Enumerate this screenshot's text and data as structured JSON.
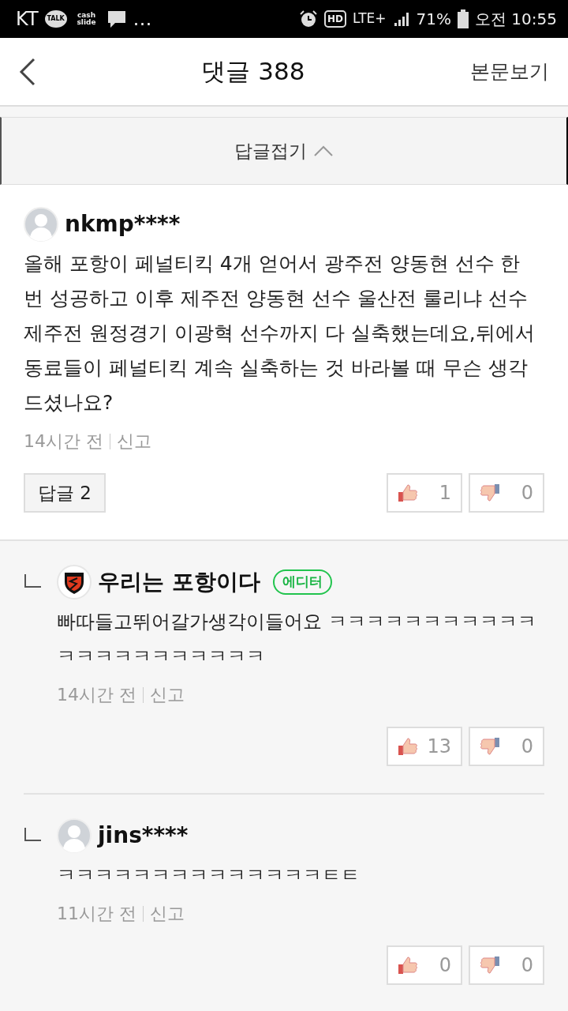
{
  "status_bar": {
    "carrier": "KT",
    "talk": "TALK",
    "cash": "cash slide",
    "more": "…",
    "hd": "HD",
    "network": "LTE+",
    "battery": "71%",
    "time": "오전 10:55"
  },
  "header": {
    "title": "댓글 388",
    "link": "본문보기"
  },
  "collapse": {
    "label": "답글접기"
  },
  "comment": {
    "avatar": {
      "kind": "default"
    },
    "author": "nkmp****",
    "body": "올해 포항이 페널티킥 4개 얻어서 광주전 양동현 선수 한 번 성공하고 이후 제주전 양동현 선수 울산전 룰리냐 선수 제주전 원정경기 이광혁 선수까지 다 실축했는데요,뒤에서 동료들이 페널티킥 계속 실축하는 것 바라볼 때 무슨 생각 드셨나요?",
    "time": "14시간 전",
    "report": "신고",
    "replies_button": "답글 2",
    "likes": "1",
    "dislikes": "0"
  },
  "replies": [
    {
      "avatar": {
        "kind": "logo"
      },
      "author": "우리는 포항이다",
      "badge": "에디터",
      "body": "빠따들고뛰어갈가생각이들어요 ㅋㅋㅋㅋㅋㅋㅋㅋㅋㅋㅋㅋㅋㅋㅋㅋㅋㅋㅋㅋㅋㅋ",
      "time": "14시간 전",
      "report": "신고",
      "likes": "13",
      "dislikes": "0"
    },
    {
      "avatar": {
        "kind": "default"
      },
      "author": "jins****",
      "body": "ㅋㅋㅋㅋㅋㅋㅋㅋㅋㅋㅋㅋㅋㅋㅌㅌ",
      "time": "11시간 전",
      "report": "신고",
      "likes": "0",
      "dislikes": "0"
    }
  ]
}
